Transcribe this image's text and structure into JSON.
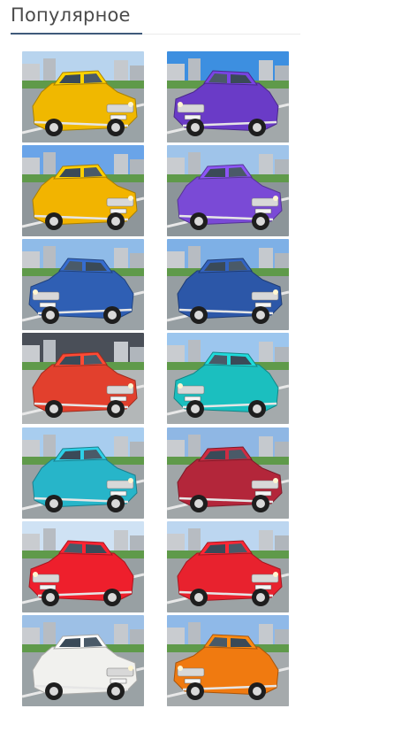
{
  "section": {
    "title": "Популярное"
  },
  "gallery": {
    "items": [
      {
        "car": "#f0b800",
        "sky": "#b8d4ee",
        "ground": "#9aa3a6",
        "view": "front"
      },
      {
        "car": "#6a3bc7",
        "sky": "#3d8fe0",
        "ground": "#a2a8aa",
        "view": "front"
      },
      {
        "car": "#f2b400",
        "sky": "#6aa4e8",
        "ground": "#8e969a",
        "view": "rear"
      },
      {
        "car": "#7a4ad6",
        "sky": "#9fc4ea",
        "ground": "#8c9599",
        "view": "rear"
      },
      {
        "car": "#2f5fb4",
        "sky": "#8fbbe8",
        "ground": "#9aa2a6",
        "view": "front"
      },
      {
        "car": "#2c57a8",
        "sky": "#7eb0e6",
        "ground": "#969ea2",
        "view": "rear"
      },
      {
        "car": "#e2402d",
        "sky": "#4a4f58",
        "ground": "#b3b7b8",
        "view": "front"
      },
      {
        "car": "#1bbfbf",
        "sky": "#9cc6ee",
        "ground": "#a4aaac",
        "view": "front"
      },
      {
        "car": "#27b5c9",
        "sky": "#a8cdef",
        "ground": "#9aa1a4",
        "view": "rear"
      },
      {
        "car": "#b3263a",
        "sky": "#8fb7e4",
        "ground": "#a0a6a8",
        "view": "rear"
      },
      {
        "car": "#ee1f2c",
        "sky": "#cfe2f4",
        "ground": "#98a0a3",
        "view": "front"
      },
      {
        "car": "#e8222e",
        "sky": "#bcd6f0",
        "ground": "#9ca3a5",
        "view": "rear"
      },
      {
        "car": "#f1f1ee",
        "sky": "#9dc0e6",
        "ground": "#9aa2a5",
        "view": "front"
      },
      {
        "car": "#f07a10",
        "sky": "#8fb9e8",
        "ground": "#a5aaac",
        "view": "rear"
      }
    ]
  }
}
